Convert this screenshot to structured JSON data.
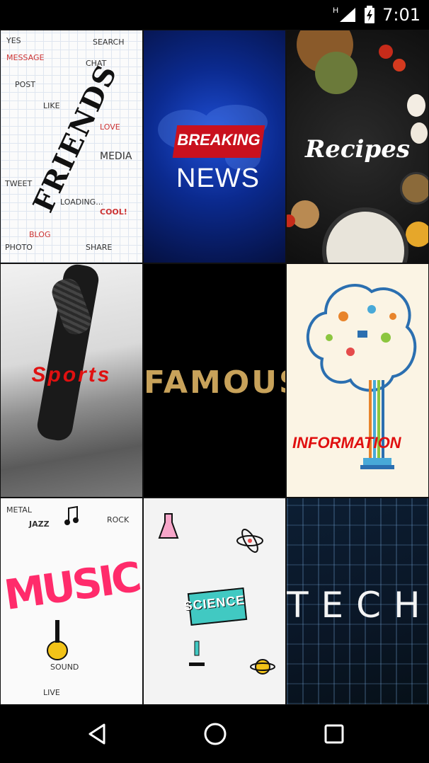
{
  "status_bar": {
    "time": "7:01",
    "network_indicator": "H",
    "icons": [
      "signal-icon",
      "battery-charging-icon"
    ]
  },
  "grid": {
    "tiles": [
      {
        "label": "FRIENDS",
        "doodles": [
          "YES",
          "MESSAGE",
          "CHAT",
          "SEARCH",
          "POST",
          "LIKE",
          "MEDIA",
          "TWEET",
          "LOVE",
          "COOL!",
          "BLOG",
          "SHARE",
          "PHOTO",
          "LOADING..."
        ]
      },
      {
        "label_line1": "BREAKING",
        "label_line2": "NEWS"
      },
      {
        "label": "Recipes"
      },
      {
        "label": "Sports"
      },
      {
        "label": "FAMOUS"
      },
      {
        "label": "INFORMATION"
      },
      {
        "label": "MUSIC",
        "doodles": [
          "METAL",
          "JAZZ",
          "ROCK",
          "SOUND",
          "LIVE"
        ]
      },
      {
        "label": "SCIENCE"
      },
      {
        "label": "TECH"
      }
    ]
  },
  "nav_bar": {
    "buttons": [
      "back-icon",
      "home-icon",
      "recents-icon"
    ]
  },
  "colors": {
    "news_red": "#c9111e",
    "famous_gold": "#c8a25a",
    "sports_red": "#e01010",
    "science_teal": "#41c9c2"
  }
}
